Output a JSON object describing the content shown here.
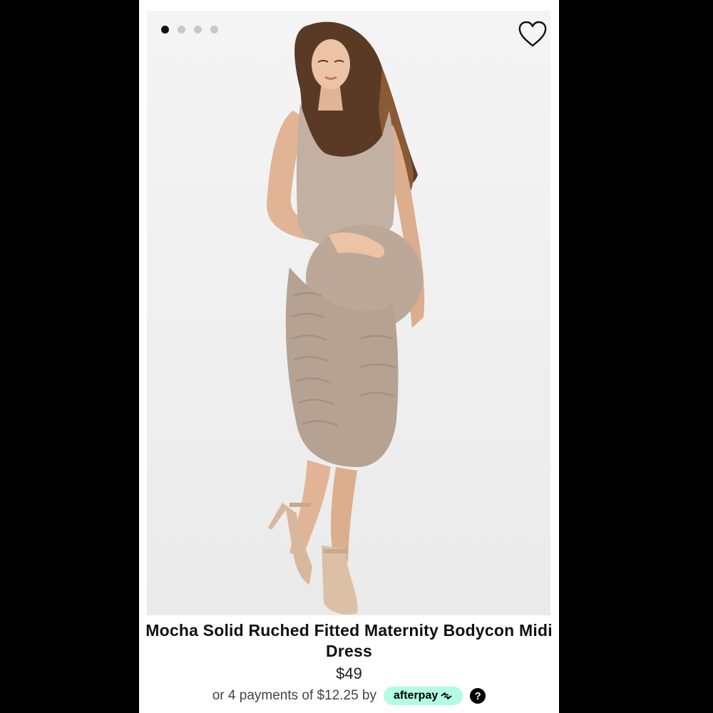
{
  "product": {
    "title": "Mocha Solid Ruched Fitted Maternity Bodycon Midi Dress",
    "price": "$49",
    "installments": {
      "prefix": "or 4 payments of $12.25 by",
      "provider": "afterpay",
      "help_label": "?"
    }
  },
  "gallery": {
    "image_count": 4,
    "active_index": 0,
    "image_subject": "model-wearing-mocha-maternity-dress"
  },
  "icons": {
    "favorite": "heart-outline-icon",
    "afterpay_arrows": "afterpay-arrows-icon",
    "help": "question-circle-icon"
  },
  "colors": {
    "background": "#000000",
    "card": "#ffffff",
    "photo_bg": "#efefef",
    "dress": "#bba899",
    "afterpay_badge": "#b2fce4",
    "dot_active": "#111111",
    "dot_inactive": "#c8c8c8"
  }
}
